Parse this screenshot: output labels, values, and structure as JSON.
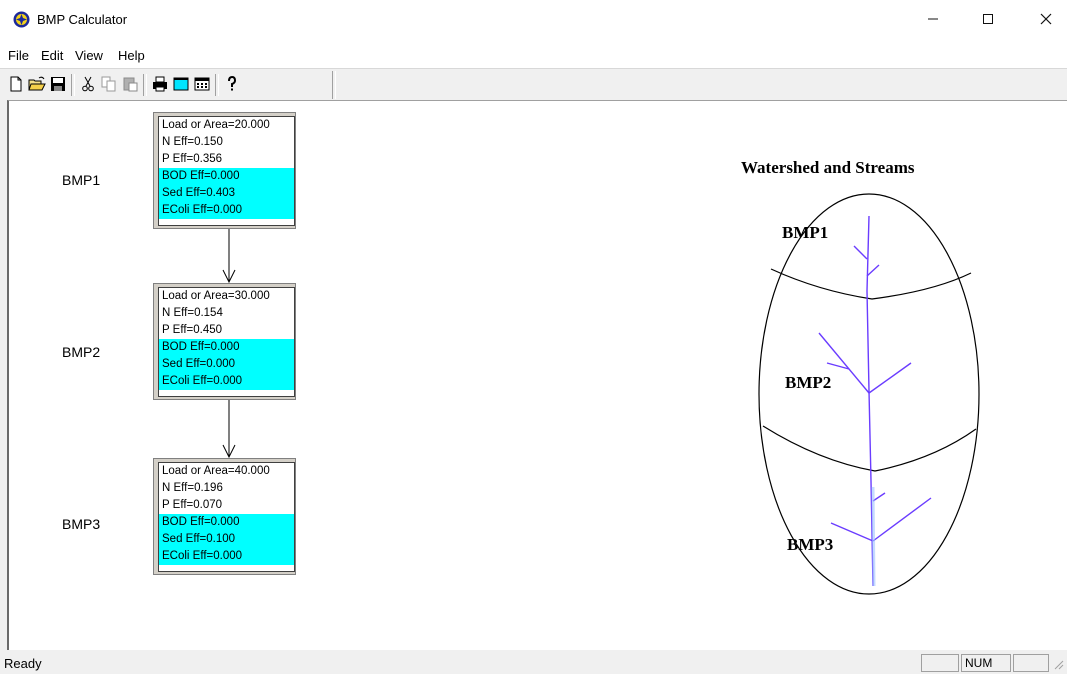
{
  "window": {
    "title": "BMP Calculator"
  },
  "menu": [
    "File",
    "Edit",
    "View",
    "Help"
  ],
  "toolbar": {
    "icons": [
      "new-file-icon",
      "open-folder-icon",
      "save-icon",
      "cut-icon",
      "copy-icon",
      "paste-icon",
      "print-icon",
      "window-icon",
      "calendar-icon",
      "help-icon"
    ]
  },
  "bmps": [
    {
      "label": "BMP1",
      "lines": [
        "Load or Area=20.000",
        "N Eff=0.150",
        "P Eff=0.356",
        "BOD Eff=0.000",
        "Sed Eff=0.403",
        "EColi Eff=0.000"
      ]
    },
    {
      "label": "BMP2",
      "lines": [
        "Load or Area=30.000",
        "N Eff=0.154",
        "P Eff=0.450",
        "BOD Eff=0.000",
        "Sed Eff=0.000",
        "EColi Eff=0.000"
      ]
    },
    {
      "label": "BMP3",
      "lines": [
        "Load or Area=40.000",
        "N Eff=0.196",
        "P Eff=0.070",
        "BOD Eff=0.000",
        "Sed Eff=0.100",
        "EColi Eff=0.000"
      ]
    }
  ],
  "watershed": {
    "title": "Watershed and Streams",
    "labels": [
      "BMP1",
      "BMP2",
      "BMP3"
    ]
  },
  "status": {
    "text": "Ready",
    "num": "NUM"
  },
  "colors": {
    "highlight": "#00ffff",
    "stream": "#6a3cff"
  }
}
